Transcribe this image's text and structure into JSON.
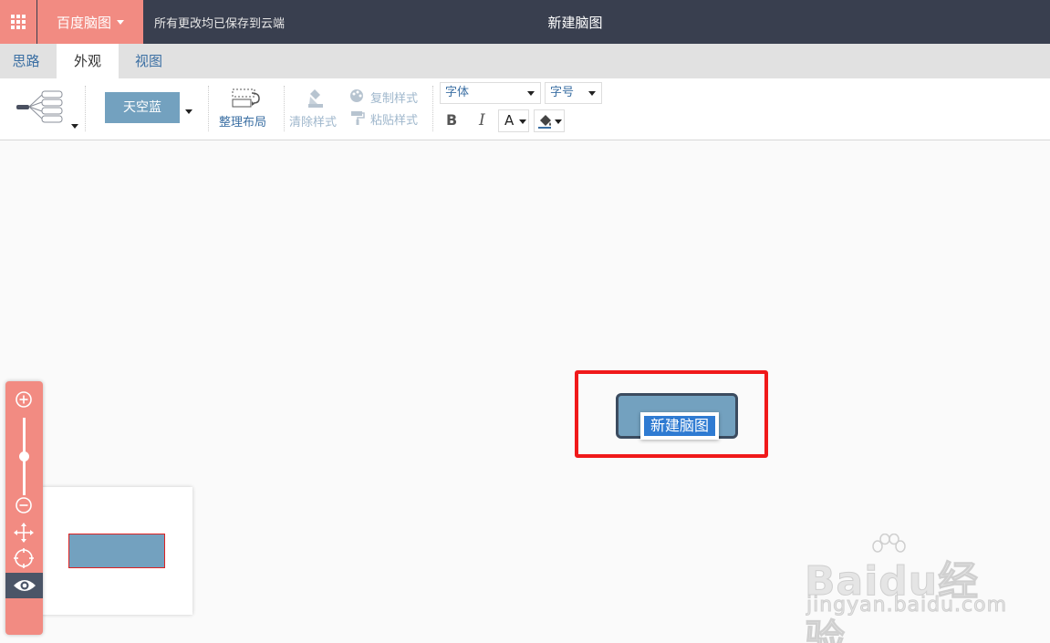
{
  "header": {
    "brand_label": "百度脑图",
    "save_status": "所有更改均已保存到云端",
    "document_title": "新建脑图"
  },
  "tabs": [
    {
      "label": "思路",
      "active": false
    },
    {
      "label": "外观",
      "active": true
    },
    {
      "label": "视图",
      "active": false
    }
  ],
  "toolbar": {
    "theme_label": "天空蓝",
    "tidy_layout_label": "整理布局",
    "clear_style_label": "清除样式",
    "copy_style_label": "复制样式",
    "paste_style_label": "粘贴样式",
    "font_family_value": "字体",
    "font_size_value": "字号",
    "bold_label": "B",
    "italic_label": "I",
    "font_color_label": "A"
  },
  "canvas": {
    "root_topic_text": "新建脑图"
  },
  "watermark": {
    "brand": "Baidu经验",
    "url": "jingyan.baidu.com"
  },
  "colors": {
    "topbar_bg": "#393f4f",
    "brand_accent": "#f28b82",
    "theme_sky_blue": "#73a1bf",
    "link_blue": "#3b6fa3",
    "highlight_red": "#f0191a",
    "selection_blue": "#2f7bd2"
  },
  "icons": [
    "apps-grid-icon",
    "structure-icon",
    "tidy-layout-icon",
    "clear-style-icon",
    "copy-style-icon",
    "paste-style-icon",
    "background-color-icon",
    "zoom-in-icon",
    "zoom-out-icon",
    "move-icon",
    "locate-icon",
    "eye-icon"
  ]
}
